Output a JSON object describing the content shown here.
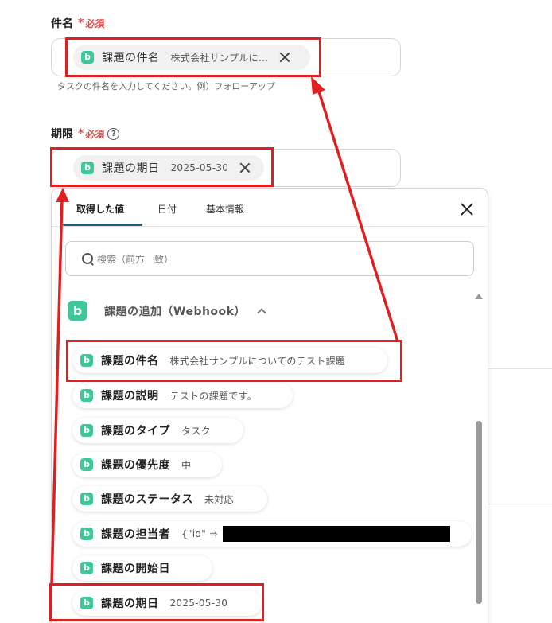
{
  "subject_field": {
    "label": "件名",
    "required_star": "*",
    "required_text": "必須",
    "chip": {
      "name": "課題の件名",
      "value": "株式会社サンプルに...",
      "logo": "b"
    },
    "hint": "タスクの件名を入力してください。例）フォローアップ"
  },
  "due_field": {
    "label": "期限",
    "required_star": "*",
    "required_text": "必須",
    "help": "?",
    "chip": {
      "name": "課題の期日",
      "value": "2025-05-30",
      "logo": "b"
    }
  },
  "panel": {
    "tabs": [
      {
        "label": "取得した値"
      },
      {
        "label": "日付"
      },
      {
        "label": "基本情報"
      }
    ],
    "search_placeholder": "検索（前方一致）",
    "group": {
      "logo": "b",
      "title": "課題の追加（Webhook）"
    },
    "items": [
      {
        "logo": "b",
        "name": "課題の件名",
        "value": "株式会社サンプルについてのテスト課題"
      },
      {
        "logo": "b",
        "name": "課題の説明",
        "value": "テストの課題です。"
      },
      {
        "logo": "b",
        "name": "課題のタイプ",
        "value": "タスク"
      },
      {
        "logo": "b",
        "name": "課題の優先度",
        "value": "中"
      },
      {
        "logo": "b",
        "name": "課題のステータス",
        "value": "未対応"
      },
      {
        "logo": "b",
        "name": "課題の担当者",
        "value": "{\"id\" ⇒"
      },
      {
        "logo": "b",
        "name": "課題の開始日",
        "value": ""
      },
      {
        "logo": "b",
        "name": "課題の期日",
        "value": "2025-05-30"
      }
    ]
  },
  "colors": {
    "accent_red": "#e02020",
    "brand_green": "#3fc69a",
    "tab_underline": "#1c5d78",
    "required": "#e04a4a"
  }
}
